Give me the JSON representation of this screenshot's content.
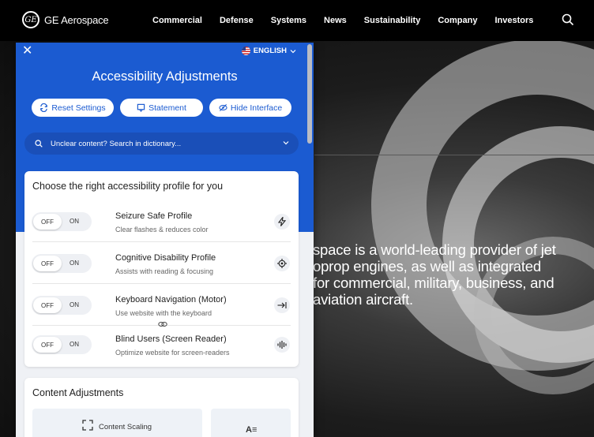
{
  "site": {
    "brand": "GE Aerospace",
    "logo_text": "GE",
    "nav": [
      "Commercial",
      "Defense",
      "Systems",
      "News",
      "Sustainability",
      "Company",
      "Investors"
    ],
    "hero_lines": [
      "space is a world-leading provider of jet",
      "oprop engines, as well as integrated",
      "for commercial, military, business, and",
      "aviation aircraft."
    ]
  },
  "panel": {
    "language": "ENGLISH",
    "title": "Accessibility Adjustments",
    "buttons": {
      "reset": "Reset Settings",
      "statement": "Statement",
      "hide": "Hide Interface"
    },
    "dictionary_placeholder": "Unclear content? Search in dictionary...",
    "profiles_heading": "Choose the right accessibility profile for you",
    "toggle_off": "OFF",
    "toggle_on": "ON",
    "profiles": [
      {
        "title": "Seizure Safe Profile",
        "subtitle": "Clear flashes & reduces color",
        "icon": "lightning-icon"
      },
      {
        "title": "Cognitive Disability Profile",
        "subtitle": "Assists with reading & focusing",
        "icon": "target-icon"
      },
      {
        "title": "Keyboard Navigation (Motor)",
        "subtitle": "Use website with the keyboard",
        "icon": "tab-arrow-icon"
      },
      {
        "title": "Blind Users (Screen Reader)",
        "subtitle": "Optimize website for screen-readers",
        "icon": "audio-wave-icon"
      }
    ],
    "content_heading": "Content Adjustments",
    "content_tiles": {
      "scaling": "Content Scaling",
      "readable_glyph": "A≡"
    }
  },
  "colors": {
    "panel_blue": "#1b5bd1",
    "nav_bg": "#000000"
  }
}
